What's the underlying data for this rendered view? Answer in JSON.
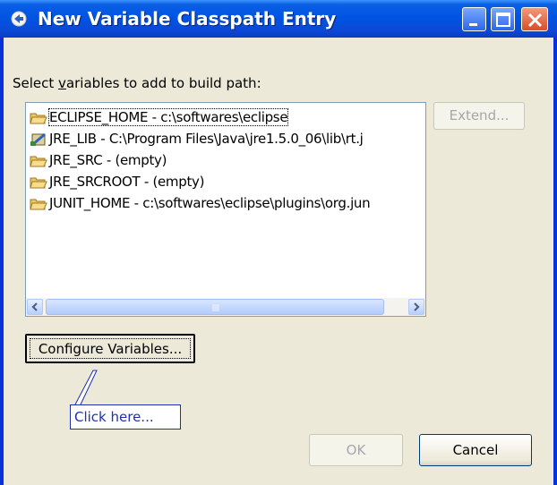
{
  "window": {
    "title": "New Variable Classpath Entry",
    "controls": [
      "minimize",
      "maximize",
      "close"
    ]
  },
  "dialog": {
    "prompt_pre": "Select ",
    "prompt_mnemonic": "v",
    "prompt_post": "ariables to add to build path:",
    "variables": [
      {
        "name": "ECLIPSE_HOME - c:\\softwares\\eclipse",
        "icon": "folder-icon",
        "selected": true
      },
      {
        "name": "JRE_LIB - C:\\Program Files\\Java\\jre1.5.0_06\\lib\\rt.j",
        "icon": "jar-icon",
        "selected": false
      },
      {
        "name": "JRE_SRC - (empty)",
        "icon": "folder-icon",
        "selected": false
      },
      {
        "name": "JRE_SRCROOT - (empty)",
        "icon": "folder-icon",
        "selected": false
      },
      {
        "name": "JUNIT_HOME - c:\\softwares\\eclipse\\plugins\\org.jun",
        "icon": "folder-icon",
        "selected": false
      }
    ],
    "extend_label": "Extend...",
    "configure_label": "Configure Variables...",
    "ok_label": "OK",
    "cancel_label": "Cancel"
  },
  "annotation": {
    "callout_text": "Click here..."
  },
  "colors": {
    "titlebar": "#0054e3",
    "dialog_bg": "#ece9d8",
    "callout": "#1f2fb0"
  }
}
